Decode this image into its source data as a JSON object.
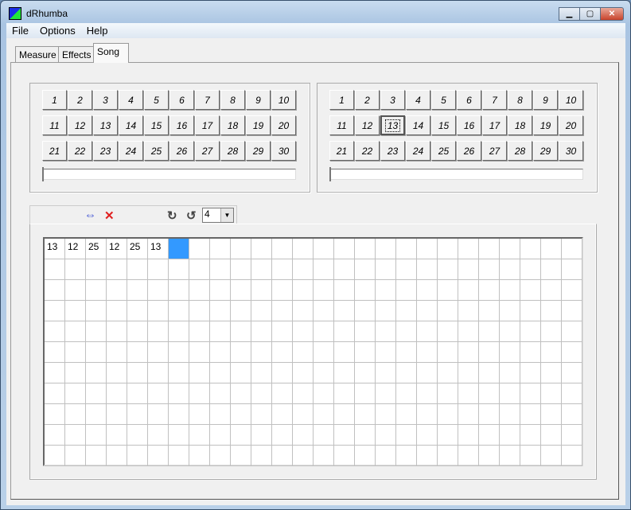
{
  "window": {
    "title": "dRhumba",
    "minimize": "▁",
    "maximize": "▢",
    "close": "✕"
  },
  "menu": [
    "File",
    "Options",
    "Help"
  ],
  "tabs": [
    "Measure",
    "Effects",
    "Song"
  ],
  "active_tab": "Song",
  "left_pattern": {
    "buttons": [
      "1",
      "2",
      "3",
      "4",
      "5",
      "6",
      "7",
      "8",
      "9",
      "10",
      "11",
      "12",
      "13",
      "14",
      "15",
      "16",
      "17",
      "18",
      "19",
      "20",
      "21",
      "22",
      "23",
      "24",
      "25",
      "26",
      "27",
      "28",
      "29",
      "30"
    ],
    "selected": null,
    "slider": 0
  },
  "right_pattern": {
    "buttons": [
      "1",
      "2",
      "3",
      "4",
      "5",
      "6",
      "7",
      "8",
      "9",
      "10",
      "11",
      "12",
      "13",
      "14",
      "15",
      "16",
      "17",
      "18",
      "19",
      "20",
      "21",
      "22",
      "23",
      "24",
      "25",
      "26",
      "27",
      "28",
      "29",
      "30"
    ],
    "selected": "13",
    "slider": 0
  },
  "toolbar": {
    "icons": [
      "swap-icon",
      "delete-icon",
      "redo-icon",
      "undo-icon"
    ],
    "combo_value": "4"
  },
  "song": {
    "cells": [
      "13",
      "12",
      "25",
      "12",
      "25",
      "13"
    ],
    "current_index": 6
  },
  "colors": {
    "selection": "#3399ff",
    "delete": "#e02020",
    "swap": "#2a3fd0"
  }
}
